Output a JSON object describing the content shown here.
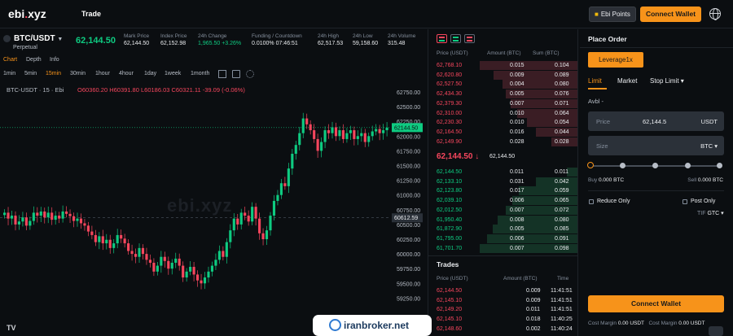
{
  "header": {
    "logo_main": "ebi",
    "logo_dot": ".",
    "logo_tail": "xyz",
    "nav_trade": "Trade",
    "points_label": "Ebi Points",
    "connect_label": "Connect Wallet",
    "globe_icon": "globe-icon"
  },
  "ticker": {
    "pair": "BTC/USDT",
    "pair_sub": "Perpetual",
    "last_price": "62,144.50",
    "stats": [
      {
        "label": "Mark Price",
        "value": "62,144.50"
      },
      {
        "label": "Index Price",
        "value": "62,152.98"
      },
      {
        "label": "24h Change",
        "value": "1,965.50 +3.26%"
      },
      {
        "label": "Funding / Countdown",
        "value": "0.0100% 07:46:51"
      },
      {
        "label": "24h High",
        "value": "62,517.53"
      },
      {
        "label": "24h Low",
        "value": "59,158.60"
      },
      {
        "label": "24h Volume",
        "value": "315.48"
      }
    ]
  },
  "chart_tabs": [
    "Chart",
    "Depth",
    "Info"
  ],
  "intervals": [
    "1min",
    "5min",
    "15min",
    "30min",
    "1hour",
    "4hour",
    "1day",
    "1week",
    "1month"
  ],
  "active_interval": "15min",
  "chart": {
    "symbol_line": "BTC-USDT · 15 · Ebi",
    "ohlc": "O60360.20 H60391.80 L60186.03 C60321.11 -39.09 (-0.06%)",
    "watermark": "ebi.xyz",
    "tv_logo": "TV",
    "price_axis": [
      "62750.00",
      "62500.00",
      "62250.00",
      "62000.00",
      "61750.00",
      "61500.00",
      "61250.00",
      "61000.00",
      "60750.00",
      "60500.00",
      "60250.00",
      "60000.00",
      "59750.00",
      "59500.00",
      "59250.00"
    ],
    "current_price_tag": "62144.50",
    "crosshair_price_tag": "60612.59",
    "up_color": "#0ecb81",
    "down_color": "#f6465d"
  },
  "orderbook": {
    "headers": [
      "Price (USDT)",
      "Amount (BTC)",
      "Sum (BTC)"
    ],
    "asks": [
      [
        "62,768.10",
        "0.015",
        "0.104"
      ],
      [
        "62,620.80",
        "0.009",
        "0.089"
      ],
      [
        "62,527.50",
        "0.004",
        "0.080"
      ],
      [
        "62,434.30",
        "0.005",
        "0.076"
      ],
      [
        "62,379.30",
        "0.007",
        "0.071"
      ],
      [
        "62,310.00",
        "0.010",
        "0.064"
      ],
      [
        "62,230.30",
        "0.010",
        "0.054"
      ],
      [
        "62,164.50",
        "0.016",
        "0.044"
      ],
      [
        "62,149.90",
        "0.028",
        "0.028"
      ]
    ],
    "mid_price": "62,144.50 ↓",
    "mid_mark": "62,144.50",
    "bids": [
      [
        "62,144.50",
        "0.011",
        "0.011"
      ],
      [
        "62,133.10",
        "0.031",
        "0.042"
      ],
      [
        "62,123.80",
        "0.017",
        "0.059"
      ],
      [
        "62,039.10",
        "0.006",
        "0.065"
      ],
      [
        "62,012.50",
        "0.007",
        "0.072"
      ],
      [
        "61,950.40",
        "0.008",
        "0.080"
      ],
      [
        "61,872.90",
        "0.005",
        "0.085"
      ],
      [
        "61,795.00",
        "0.006",
        "0.091"
      ],
      [
        "61,701.70",
        "0.007",
        "0.098"
      ]
    ]
  },
  "trades": {
    "title": "Trades",
    "headers": [
      "Price (USDT)",
      "Amount (BTC)",
      "Time"
    ],
    "rows": [
      [
        "62,144.50",
        "0.009",
        "11:41:51"
      ],
      [
        "62,145.10",
        "0.009",
        "11:41:51"
      ],
      [
        "62,149.20",
        "0.011",
        "11:41:51"
      ],
      [
        "62,145.10",
        "0.018",
        "11:40:25"
      ],
      [
        "62,148.60",
        "0.002",
        "11:40:24"
      ]
    ]
  },
  "place_order": {
    "title": "Place Order",
    "leverage": "Leverage1x",
    "tabs": [
      "Limit",
      "Market",
      "Stop Limit ▾"
    ],
    "avbl": "Avbl -",
    "price_label": "Price",
    "price_value": "62,144.5",
    "price_unit": "USDT",
    "size_label": "Size",
    "size_unit": "BTC ▾",
    "buy_label": "Buy",
    "buy_value": "0.000 BTC",
    "sell_label": "Sell",
    "sell_value": "0.000 BTC",
    "reduce_only": "Reduce Only",
    "post_only": "Post Only",
    "tif_label": "TIF",
    "tif_value": "GTC ▾",
    "connect_label": "Connect Wallet",
    "cost_margin_label": "Cost Margin",
    "cost_margin_value": "0.00 USDT",
    "cost_margin_label2": "Cost Margin",
    "cost_margin_value2": "0.00 USDT"
  },
  "overlay_badge": "iranbroker.net"
}
